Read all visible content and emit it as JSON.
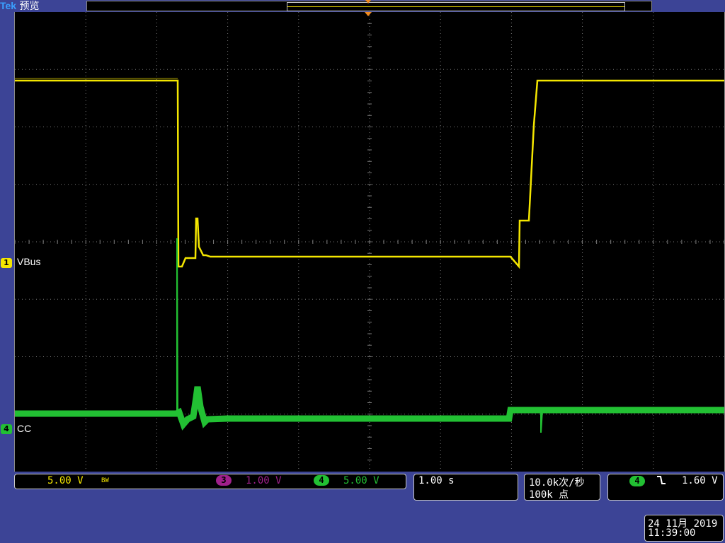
{
  "header": {
    "brand": "Tek",
    "mode_label": "预览"
  },
  "traces": {
    "ch1": {
      "label": "VBus",
      "number": "1",
      "color": "#f4e600"
    },
    "ch4": {
      "label": "CC",
      "number": "4",
      "color": "#22c033"
    }
  },
  "status": {
    "ch1": {
      "number": "1",
      "scale": "5.00 V",
      "bw_label": "BW"
    },
    "ch3": {
      "number": "3",
      "scale": "1.00 V",
      "color": "#a0208c"
    },
    "ch4": {
      "number": "4",
      "scale": "5.00 V"
    },
    "timebase": "1.00 s",
    "sample_rate": "10.0k次/秒",
    "record_length": "100k 点",
    "trigger": {
      "source": "4",
      "slope_icon": "falling-edge-icon",
      "level": "1.60 V"
    },
    "date": "24 11月 2019",
    "time": "11:39:00"
  },
  "colors": {
    "background": "#3c4496",
    "graticule": "#7a7a7a",
    "ch1": "#f4e600",
    "ch4": "#22c033",
    "trigger_marker": "#f08a20"
  }
}
